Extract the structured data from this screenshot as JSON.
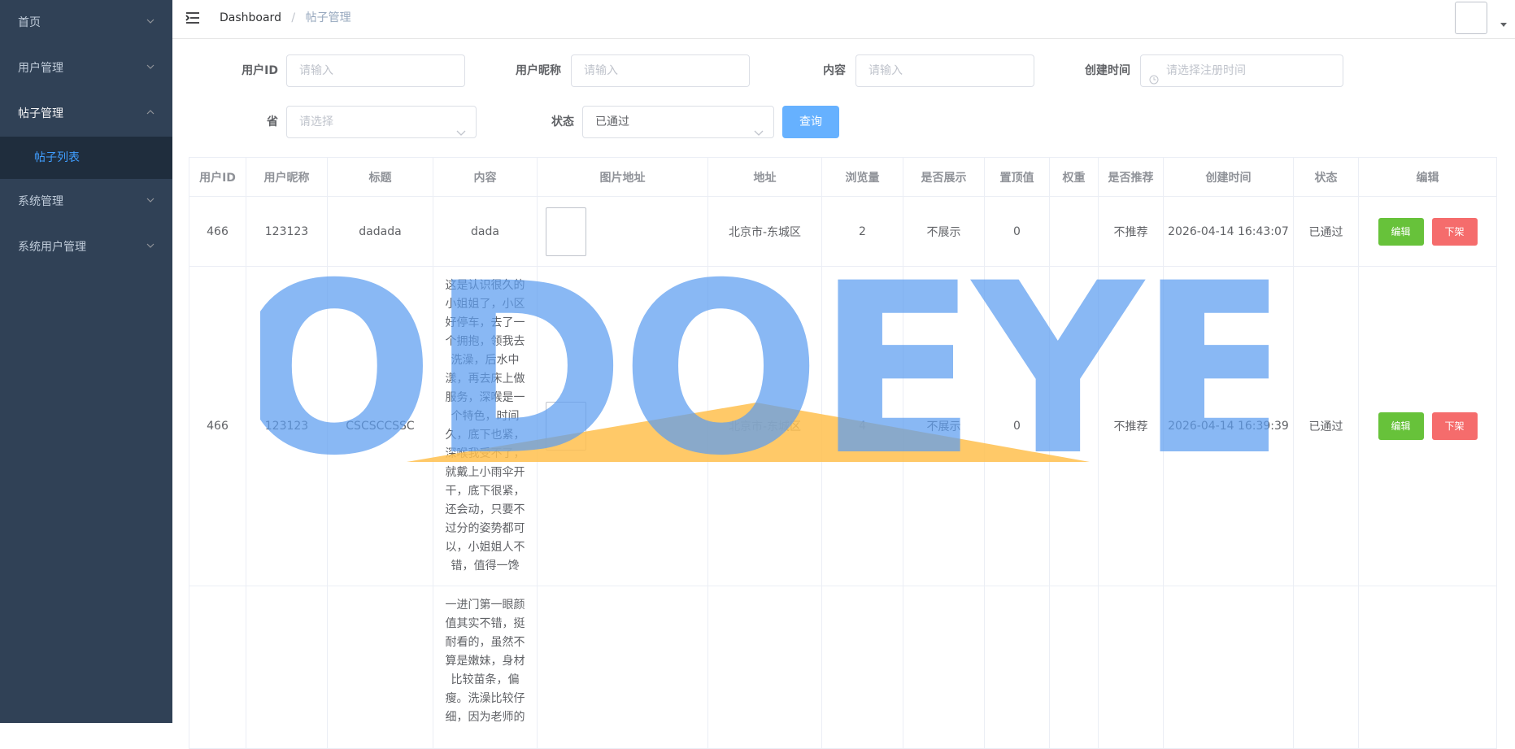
{
  "sidebar": {
    "items": [
      {
        "label": "首页"
      },
      {
        "label": "用户管理"
      },
      {
        "label": "帖子管理"
      },
      {
        "label": "系统管理"
      },
      {
        "label": "系统用户管理"
      }
    ],
    "subitem": "帖子列表"
  },
  "header": {
    "breadcrumb_home": "Dashboard",
    "breadcrumb_sep": "/",
    "breadcrumb_current": "帖子管理"
  },
  "filters": {
    "user_id_label": "用户ID",
    "user_id_placeholder": "请输入",
    "nickname_label": "用户昵称",
    "nickname_placeholder": "请输入",
    "content_label": "内容",
    "content_placeholder": "请输入",
    "created_label": "创建时间",
    "created_placeholder": "请选择注册时间",
    "province_label": "省",
    "province_placeholder": "请选择",
    "status_label": "状态",
    "status_value": "已通过",
    "query_button": "查询"
  },
  "table": {
    "headers": [
      "用户ID",
      "用户昵称",
      "标题",
      "内容",
      "图片地址",
      "地址",
      "浏览量",
      "是否展示",
      "置顶值",
      "权重",
      "是否推荐",
      "创建时间",
      "状态",
      "编辑"
    ],
    "edit_label": "编辑",
    "down_label": "下架",
    "rows": [
      {
        "user_id": "466",
        "nickname": "123123",
        "title": "dadada",
        "content": "dada",
        "address": "北京市-东城区",
        "views": "2",
        "show": "不展示",
        "top": "0",
        "weight": "",
        "recommend": "不推荐",
        "created": "2026-04-14 16:43:07",
        "status": "已通过"
      },
      {
        "user_id": "466",
        "nickname": "123123",
        "title": "CSCSCCSSC",
        "content": "这是认识很久的小姐姐了，小区好停车，去了一个拥抱，领我去洗澡，后水中漾，再去床上做服务，深喉是一个特色，时间久，底下也紧，深喉我受不了，就戴上小雨伞开干，底下很紧，还会动，只要不过分的姿势都可以，小姐姐人不错，值得一馋",
        "address": "北京市-东城区",
        "views": "4",
        "show": "不展示",
        "top": "0",
        "weight": "",
        "recommend": "不推荐",
        "created": "2026-04-14 16:39:39",
        "status": "已通过"
      },
      {
        "user_id": "",
        "nickname": "",
        "title": "",
        "content": "一进门第一眼颜值其实不错，挺耐看的，虽然不算是嫩妹，身材比较苗条，偏瘦。洗澡比较仔细，因为老师的",
        "address": "",
        "views": "",
        "show": "",
        "top": "",
        "weight": "",
        "recommend": "",
        "created": "",
        "status": ""
      }
    ]
  },
  "watermark": {
    "text": "ODOEYE",
    "color": "#5b9cf0",
    "accent": "#ffc04d"
  }
}
